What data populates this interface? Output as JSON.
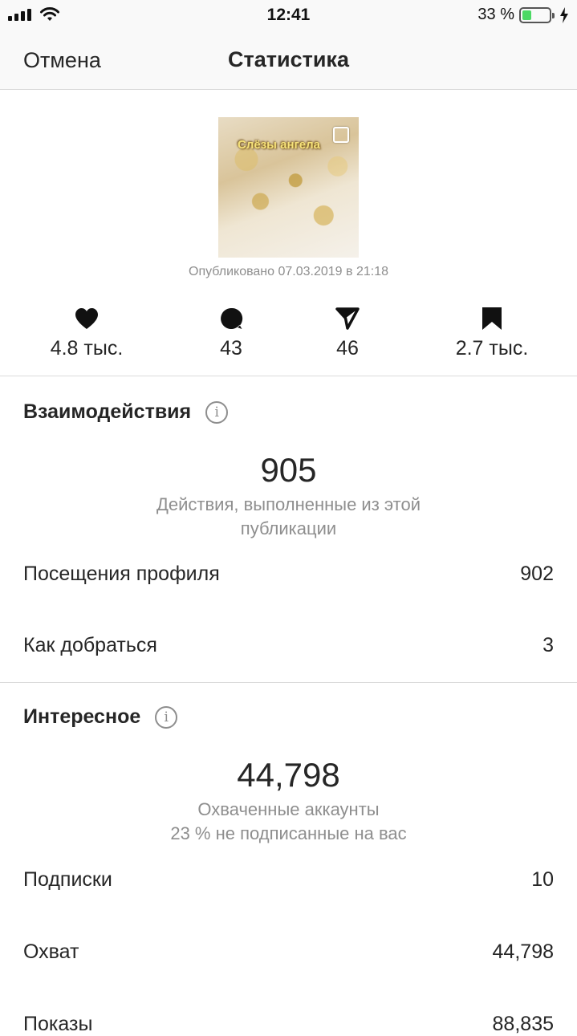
{
  "status_bar": {
    "time": "12:41",
    "battery_text": "33 %",
    "battery_level": 0.33
  },
  "nav": {
    "cancel_label": "Отмена",
    "title": "Статистика"
  },
  "post": {
    "thumbnail_caption": "Слёзы ангела",
    "published": "Опубликовано 07.03.2019 в 21:18"
  },
  "stats": [
    {
      "icon": "heart-icon",
      "value": "4.8 тыс."
    },
    {
      "icon": "comment-icon",
      "value": "43"
    },
    {
      "icon": "send-icon",
      "value": "46"
    },
    {
      "icon": "bookmark-icon",
      "value": "2.7 тыс."
    }
  ],
  "interactions": {
    "title": "Взаимодействия",
    "total": "905",
    "caption": "Действия, выполненные из этой публикации",
    "rows": [
      {
        "label": "Посещения профиля",
        "value": "902"
      },
      {
        "label": "Как добраться",
        "value": "3"
      }
    ]
  },
  "discovery": {
    "title": "Интересное",
    "total": "44,798",
    "caption": "Охваченные аккаунты",
    "subcaption": "23 % не подписанные на вас",
    "rows": [
      {
        "label": "Подписки",
        "value": "10"
      },
      {
        "label": "Охват",
        "value": "44,798"
      },
      {
        "label": "Показы",
        "value": "88,835"
      }
    ]
  },
  "colors": {
    "text": "#262626",
    "secondary": "#8e8e8e",
    "divider": "#dbdbdb",
    "battery": "#4cd964"
  }
}
